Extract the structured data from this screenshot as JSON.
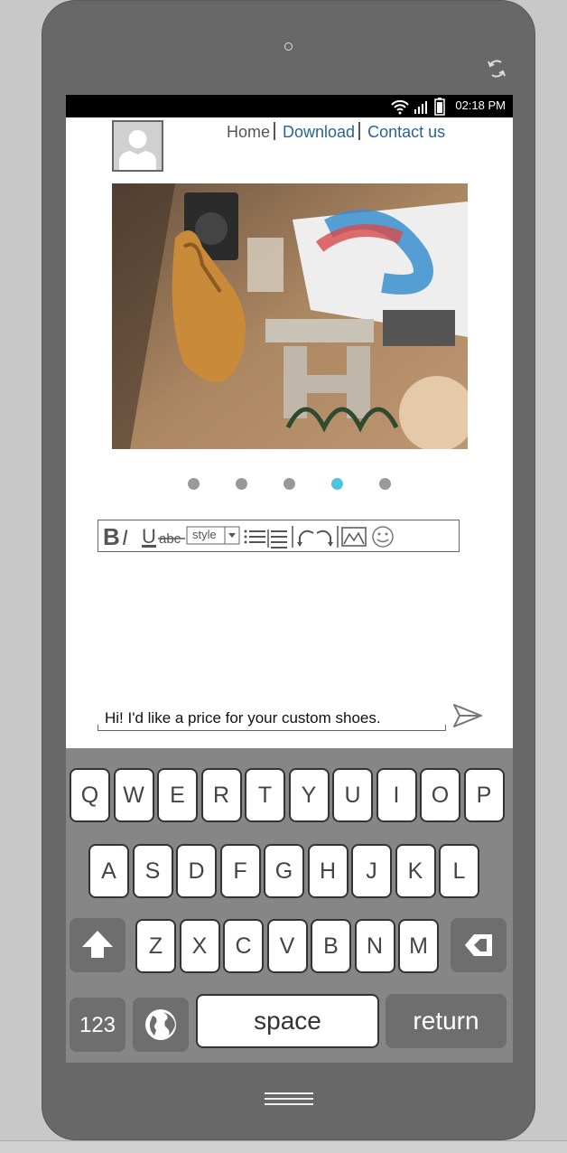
{
  "statusbar": {
    "time": "02:18 PM"
  },
  "nav": {
    "home": "Home",
    "download": "Download",
    "contact": "Contact us"
  },
  "carousel": {
    "dot_count": 5,
    "active_index": 3
  },
  "toolbar": {
    "style_label": "style"
  },
  "composer": {
    "message": "Hi! I'd like a price for your custom shoes."
  },
  "keyboard": {
    "row1": [
      "Q",
      "W",
      "E",
      "R",
      "T",
      "Y",
      "U",
      "I",
      "O",
      "P"
    ],
    "row2": [
      "A",
      "S",
      "D",
      "F",
      "G",
      "H",
      "J",
      "K",
      "L"
    ],
    "row3": [
      "Z",
      "X",
      "C",
      "V",
      "B",
      "N",
      "M"
    ],
    "numbers_label": "123",
    "space_label": "space",
    "return_label": "return"
  },
  "colors": {
    "accent": "#4ec3e0",
    "link": "#2a6496",
    "device": "#686868"
  }
}
